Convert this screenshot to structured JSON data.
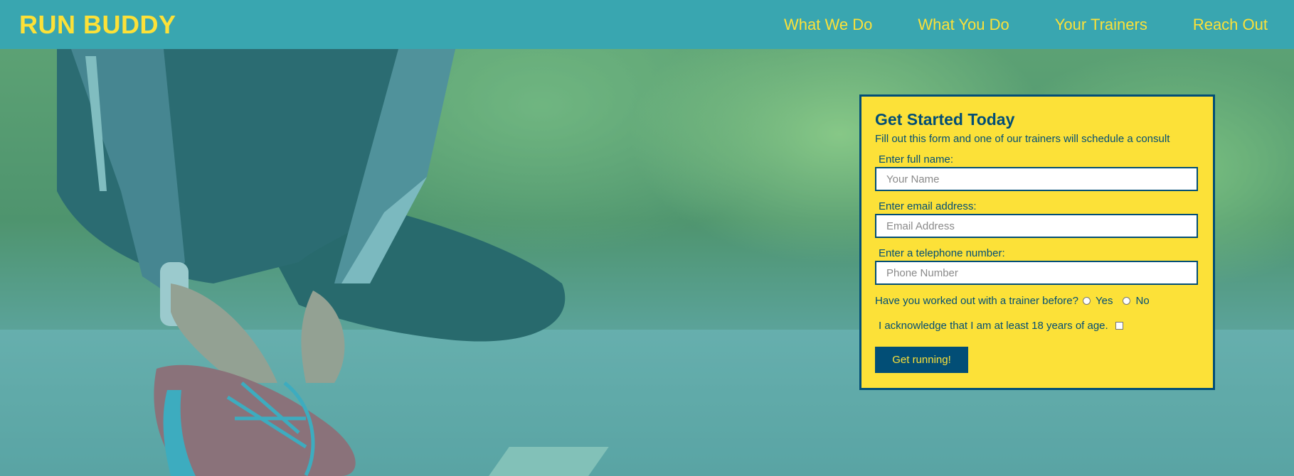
{
  "header": {
    "logo": "RUN BUDDY",
    "nav": [
      "What We Do",
      "What You Do",
      "Your Trainers",
      "Reach Out"
    ]
  },
  "form": {
    "title": "Get Started Today",
    "subtitle": "Fill out this form and one of our trainers will schedule a consult",
    "name_label": "Enter full name:",
    "name_placeholder": "Your Name",
    "email_label": "Enter email address:",
    "email_placeholder": "Email Address",
    "phone_label": "Enter a telephone number:",
    "phone_placeholder": "Phone Number",
    "trainer_question": "Have you worked out with a trainer before?",
    "yes_label": "Yes",
    "no_label": "No",
    "acknowledge": "I acknowledge that I am at least 18 years of age.",
    "submit_label": "Get running!"
  },
  "colors": {
    "primary": "#39a6b0",
    "secondary": "#fce138",
    "dark": "#024e76"
  }
}
